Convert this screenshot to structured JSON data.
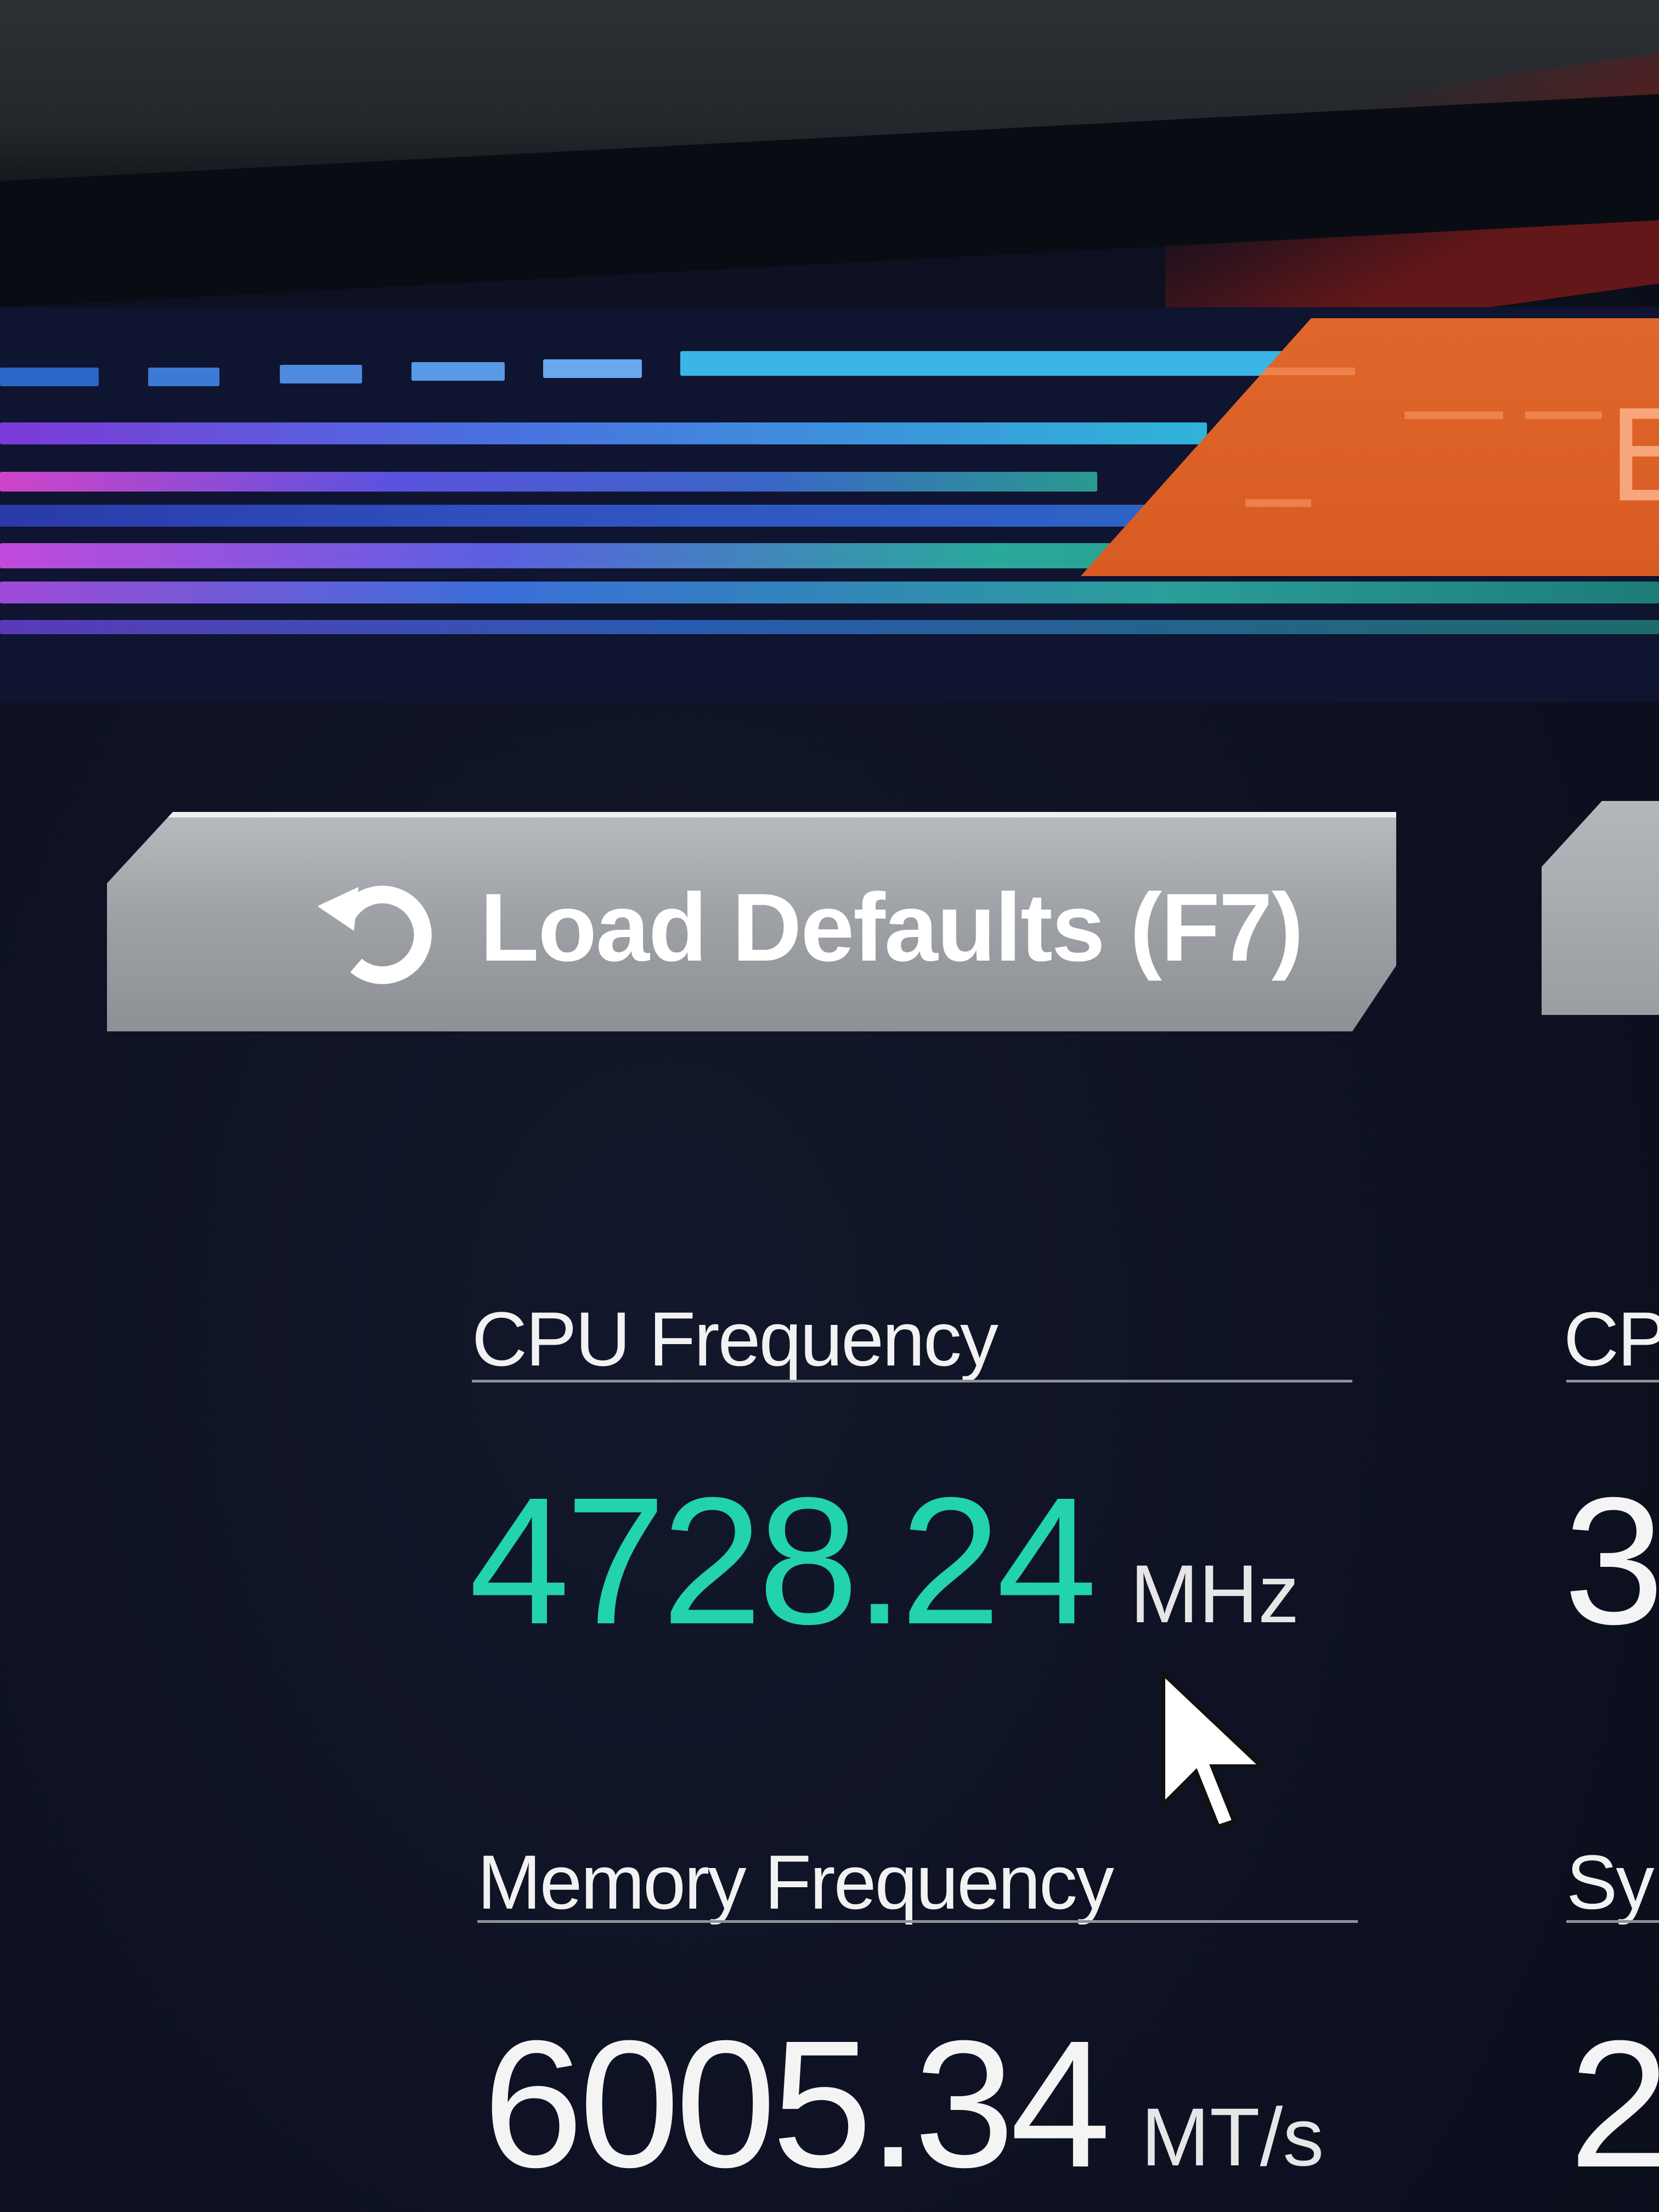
{
  "header": {
    "panel_letter": "E"
  },
  "actions": {
    "load_defaults_label": "Load Defaults (F7)"
  },
  "stats": {
    "cpu_frequency": {
      "label": "CPU Frequency",
      "value": "4728.24",
      "unit": "MHz"
    },
    "memory_frequency": {
      "label": "Memory Frequency",
      "value": "6005.34",
      "unit": "MT/s"
    },
    "right_column": {
      "cpu_label_partial": "CP",
      "cpu_value_partial": "3",
      "sys_label_partial": "Sy",
      "sys_value_partial": "2"
    }
  },
  "colors": {
    "accent_cyan": "#22d3ad",
    "accent_orange": "#e0672c",
    "background": "#0d1122"
  },
  "icons": {
    "reset": "reset-icon",
    "cursor": "mouse-pointer-icon"
  }
}
